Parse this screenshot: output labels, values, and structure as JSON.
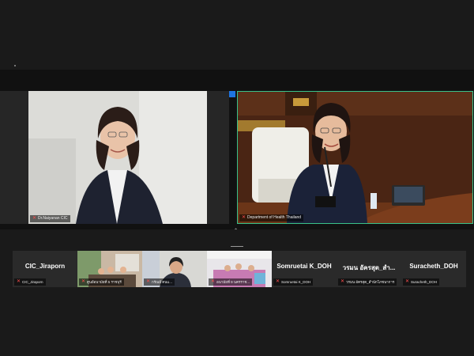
{
  "meeting": {
    "main_tiles": [
      {
        "name": "Dr.Naiyanan CIC"
      },
      {
        "name": "Department of Health Thailand"
      }
    ]
  },
  "gallery": [
    {
      "display": "CIC_Jiraporn",
      "tag": "CIC_Jiraporn",
      "video": false
    },
    {
      "display": "",
      "tag": "ศูนย์อนามัยที่ 5 ราชบุรี",
      "video": true
    },
    {
      "display": "",
      "tag": "กรัณย์ คนแ...",
      "video": true
    },
    {
      "display": "",
      "tag": "อนามัยที่ 9 นครราช...",
      "video": true
    },
    {
      "display": "Somruetai K_DOH",
      "tag": "Somruetai K_DOH",
      "video": false
    },
    {
      "display": "วรมน อัครสุต_สำ...",
      "tag": "วรมน อัครสุต_สำนักโภชนาการ",
      "video": false
    },
    {
      "display": "Suracheth_DOH",
      "tag": "Suracheth_DOH",
      "video": false
    }
  ],
  "colors": {
    "active_speaker_border": "#39c18a",
    "mic_muted": "#ff4d4d",
    "pin_badge": "#1e74e0"
  },
  "icons": [
    "mic-muted-icon",
    "pin-icon",
    "chevron-up-icon"
  ]
}
